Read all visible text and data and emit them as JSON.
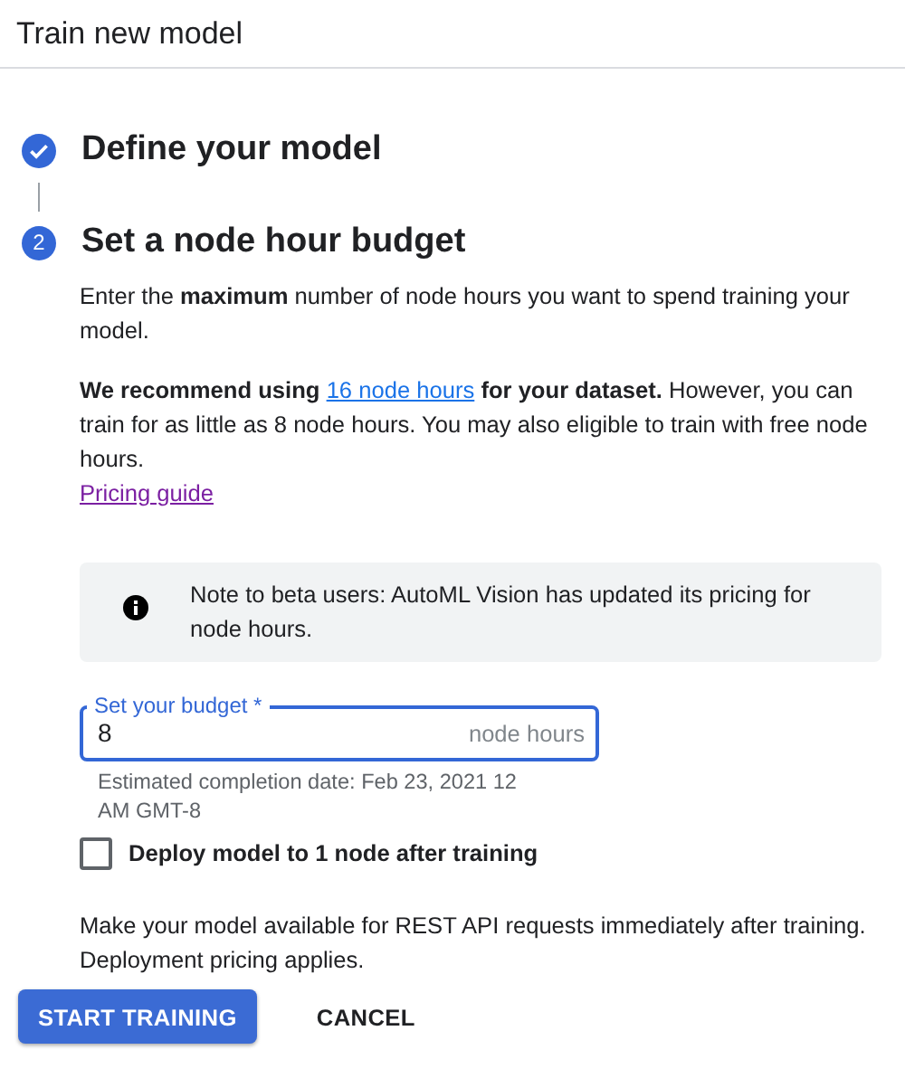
{
  "dialog": {
    "title": "Train new model"
  },
  "steps": [
    {
      "title": "Define your model",
      "completed": true
    },
    {
      "number": "2",
      "title": "Set a node hour budget",
      "completed": false
    }
  ],
  "intro": "Enter the **maximum** number of node hours you want to spend training your model.",
  "recommendation": {
    "before": "**We recommend using**",
    "link": "16 node hours",
    "after": "**for your dataset.** However, you can train for as little as 8 node hours. You may also eligible to train with free node hours."
  },
  "pricing_link": "Pricing guide",
  "notice": {
    "text": "Note to beta users: AutoML Vision has updated its pricing for node hours."
  },
  "budget_field": {
    "label": "Set your budget *",
    "value": "8",
    "suffix": "node hours",
    "focused": true,
    "helper": "Estimated completion date: Feb 23, 2021 12 AM GMT-8"
  },
  "deploy_checkbox": {
    "label": "Deploy model to 1 node after training",
    "checked": false
  },
  "deploy_note": "Make your model available for REST API requests immediately after training. Deployment pricing applies.",
  "buttons": [
    {
      "label": "START TRAINING",
      "kind": "primary"
    },
    {
      "label": "CANCEL",
      "kind": "text"
    }
  ]
}
